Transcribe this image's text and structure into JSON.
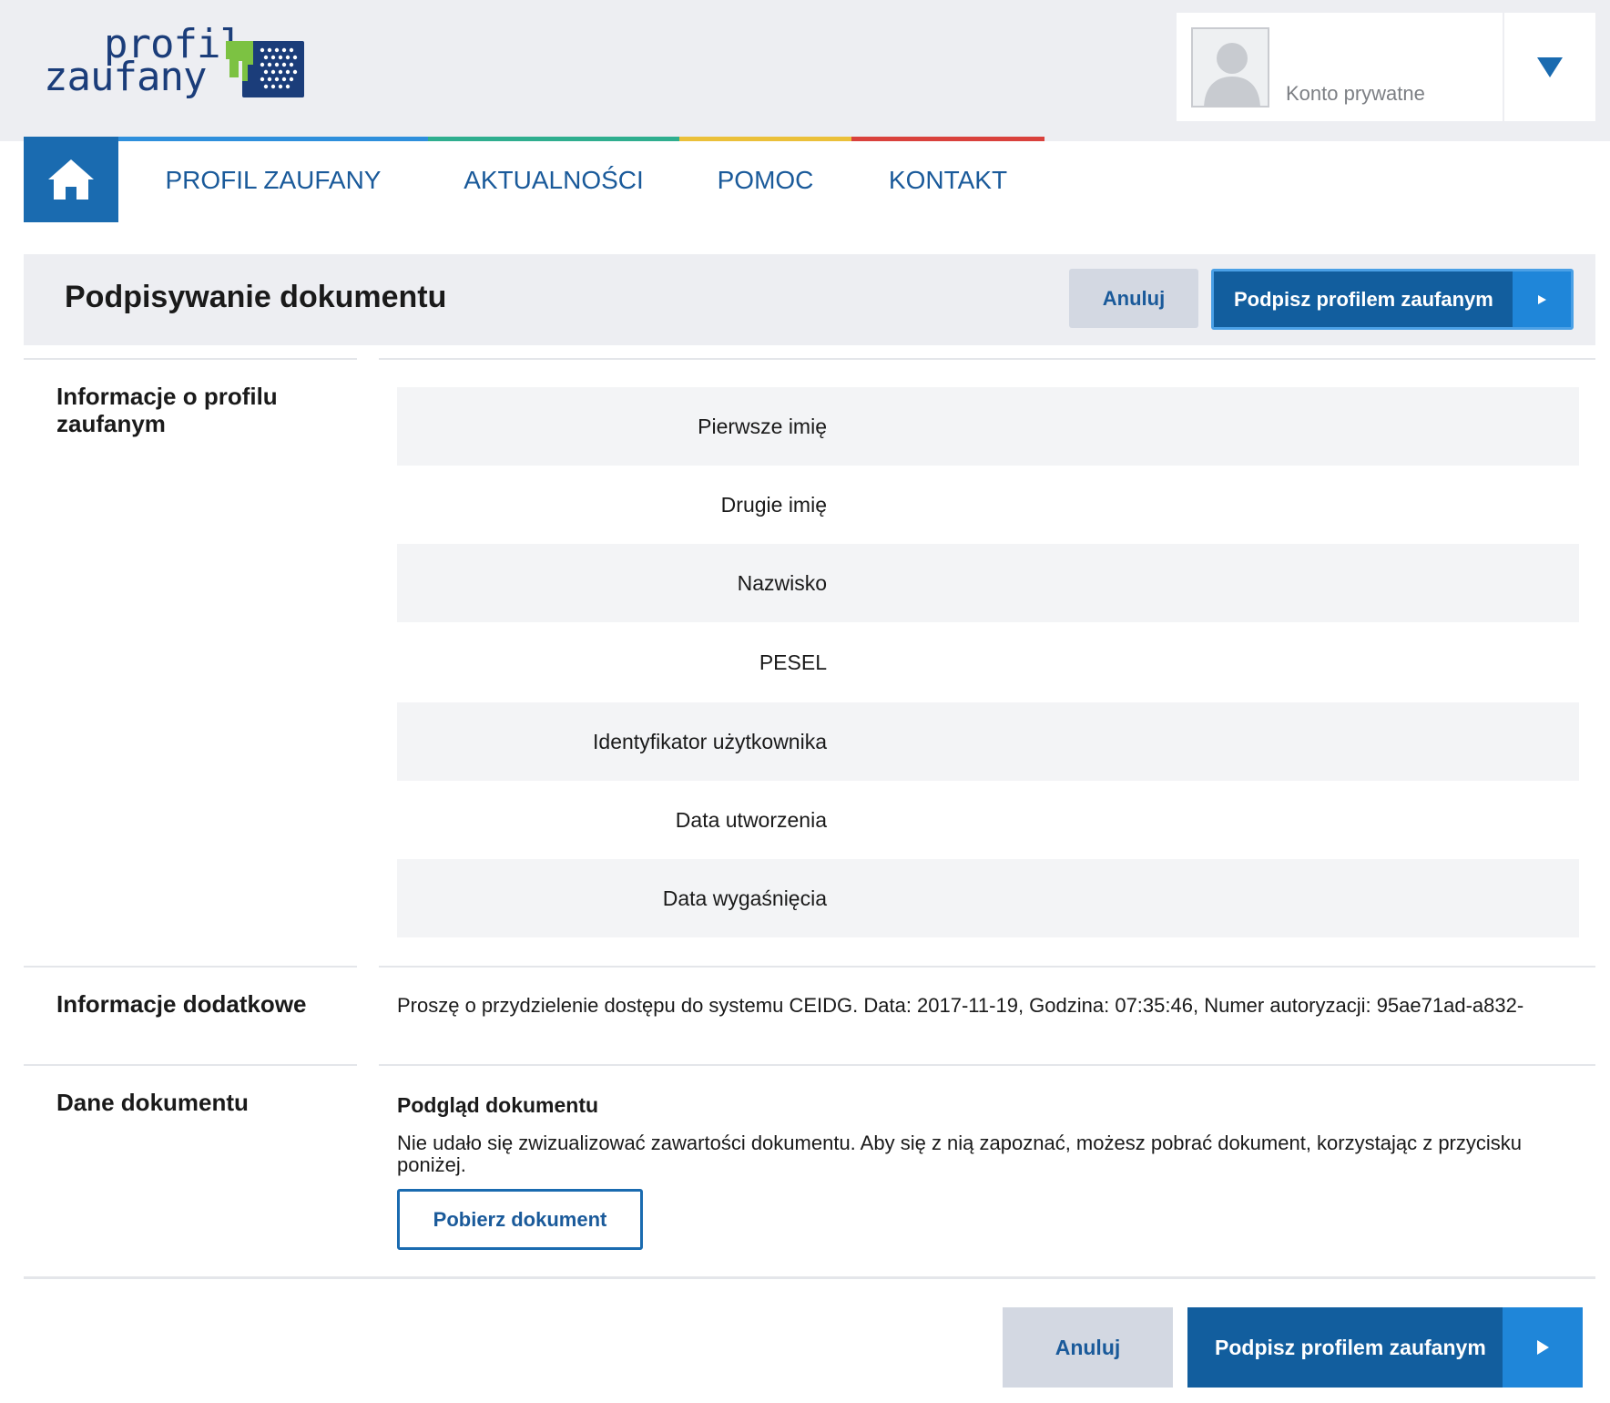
{
  "header": {
    "logo": {
      "line1": "profil",
      "line2": "zaufany"
    },
    "account": {
      "label": "Konto prywatne"
    }
  },
  "nav": {
    "items": [
      {
        "label": "PROFIL ZAUFANY"
      },
      {
        "label": "AKTUALNOŚCI"
      },
      {
        "label": "POMOC"
      },
      {
        "label": "KONTAKT"
      }
    ],
    "colors": [
      "#2e8fdc",
      "#2fae8f",
      "#ebc03a",
      "#d9413c"
    ]
  },
  "titlebar": {
    "title": "Podpisywanie dokumentu",
    "cancel_label": "Anuluj",
    "sign_label": "Podpisz profilem zaufanym"
  },
  "profile_info": {
    "heading": "Informacje o profilu zaufanym",
    "fields": [
      {
        "label": "Pierwsze imię",
        "value": ""
      },
      {
        "label": "Drugie imię",
        "value": ""
      },
      {
        "label": "Nazwisko",
        "value": ""
      },
      {
        "label": "PESEL",
        "value": ""
      },
      {
        "label": "Identyfikator użytkownika",
        "value": ""
      },
      {
        "label": "Data utworzenia",
        "value": ""
      },
      {
        "label": "Data wygaśnięcia",
        "value": ""
      }
    ]
  },
  "additional_info": {
    "heading": "Informacje dodatkowe",
    "text": "Proszę o przydzielenie dostępu do systemu CEIDG. Data: 2017-11-19, Godzina: 07:35:46, Numer autoryzacji: 95ae71ad-a832-"
  },
  "document": {
    "heading": "Dane dokumentu",
    "preview_title": "Podgląd dokumentu",
    "preview_message": "Nie udało się zwizualizować zawartości dokumentu. Aby się z nią zapoznać, możesz pobrać dokument, korzystając z przycisku poniżej.",
    "download_label": "Pobierz dokument"
  },
  "footer": {
    "cancel_label": "Anuluj",
    "sign_label": "Podpisz profilem zaufanym"
  },
  "colors": {
    "primary": "#125e9e",
    "accent": "#1f86d9",
    "link": "#1a5a9a",
    "header_bg": "#edeef2"
  }
}
